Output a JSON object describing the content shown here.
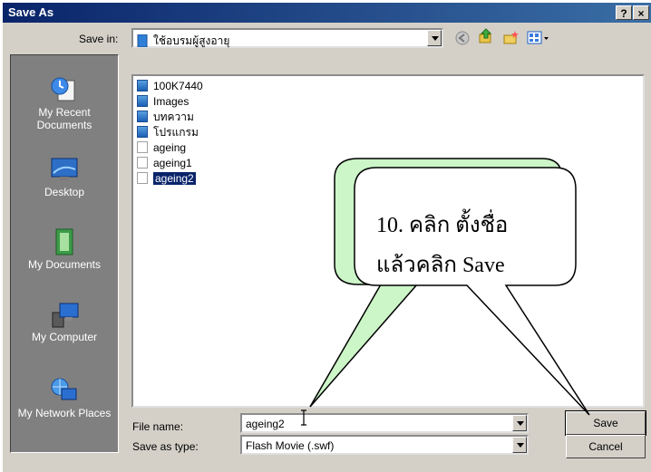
{
  "window": {
    "title": "Save As",
    "help_label": "?",
    "close_label": "×"
  },
  "toolbar": {
    "save_in_label": "Save in:",
    "save_in_value": "ใช้อบรมผู้สูงอายุ",
    "icons": [
      "back-icon",
      "up-folder-icon",
      "new-folder-icon",
      "views-menu-icon"
    ]
  },
  "places": [
    {
      "label": "My Recent Documents",
      "icon": "recent-documents-icon"
    },
    {
      "label": "Desktop",
      "icon": "desktop-icon"
    },
    {
      "label": "My Documents",
      "icon": "my-documents-icon"
    },
    {
      "label": "My Computer",
      "icon": "my-computer-icon"
    },
    {
      "label": "My Network Places",
      "icon": "network-places-icon"
    }
  ],
  "files": [
    {
      "name": "100K7440",
      "type": "folder",
      "selected": false
    },
    {
      "name": "Images",
      "type": "folder",
      "selected": false
    },
    {
      "name": "บทความ",
      "type": "folder",
      "selected": false
    },
    {
      "name": "โปรแกรม",
      "type": "folder",
      "selected": false
    },
    {
      "name": "ageing",
      "type": "file",
      "selected": false
    },
    {
      "name": "ageing1",
      "type": "file",
      "selected": false
    },
    {
      "name": "ageing2",
      "type": "file",
      "selected": true
    }
  ],
  "filename": {
    "label": "File name:",
    "value": "ageing2"
  },
  "filetype": {
    "label": "Save as type:",
    "value": "Flash Movie (.swf)"
  },
  "buttons": {
    "save": "Save",
    "cancel": "Cancel"
  },
  "annotation": {
    "line1": "10. คลิก  ตั้งชื่อ",
    "line2": "แล้วคลิก Save",
    "back_bubble_color": "#ccf5c8",
    "front_bubble_color": "#ffffff"
  },
  "colors": {
    "titlebar": "#0a246a",
    "dialog": "#d4d0c8",
    "places_bar": "#808080",
    "selection": "#0a246a"
  }
}
